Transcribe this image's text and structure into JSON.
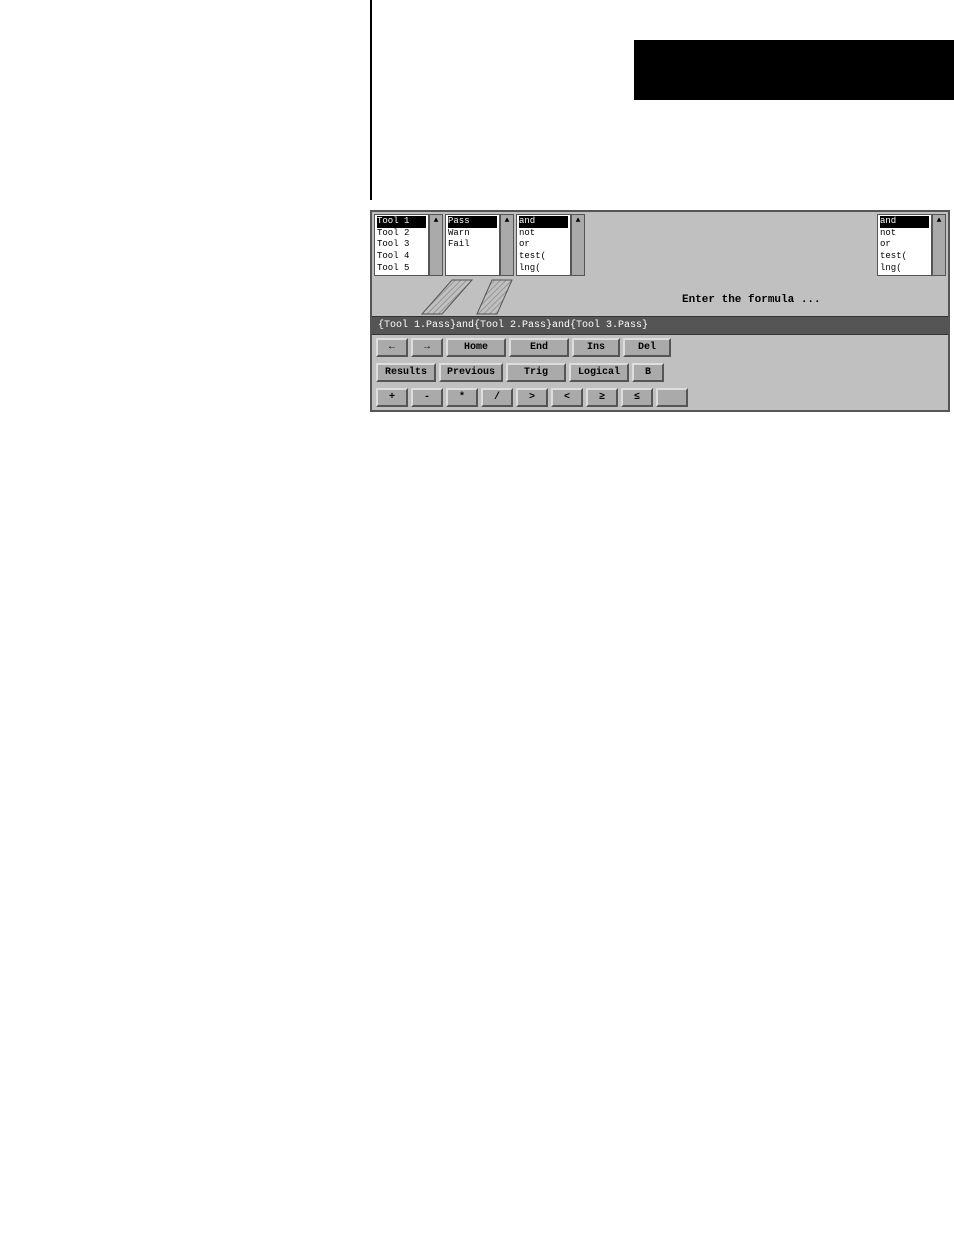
{
  "header": {
    "bar_label": ""
  },
  "dropdowns": {
    "col1": {
      "label": "Tool 1",
      "items": [
        "Tool 1",
        "Tool 2",
        "Tool 3",
        "Tool 4",
        "Tool 5"
      ],
      "selected": "Tool 1",
      "scroll_up": "▲"
    },
    "col2": {
      "label": "Pass",
      "items": [
        "Pass",
        "Warn",
        "Fail"
      ],
      "selected": "Pass",
      "scroll_up": "▲"
    },
    "col3": {
      "label": "and",
      "items": [
        "and",
        "not",
        "or",
        "test(",
        "lng("
      ],
      "selected": "and",
      "scroll_up": "▲"
    },
    "col4": {
      "label": "and",
      "items": [
        "and",
        "not",
        "or",
        "test(",
        "lng("
      ],
      "selected": "and",
      "scroll_up": "▲"
    }
  },
  "prompt": {
    "text": "Enter the formula ..."
  },
  "formula": {
    "text": "{Tool 1.Pass}and{Tool 2.Pass}and{Tool 3.Pass}"
  },
  "nav_buttons": {
    "left_arrow": "←",
    "right_arrow": "→",
    "home": "Home",
    "end": "End",
    "ins": "Ins",
    "del": "Del"
  },
  "function_buttons": {
    "results": "Results",
    "previous": "Previous",
    "trig": "Trig",
    "logical": "Logical",
    "b": "B"
  },
  "operator_buttons": {
    "plus": "+",
    "minus": "-",
    "multiply": "*",
    "divide": "/",
    "greater": ">",
    "less": "<",
    "greater_eq": "≥",
    "less_eq": "≤",
    "extra": ""
  }
}
